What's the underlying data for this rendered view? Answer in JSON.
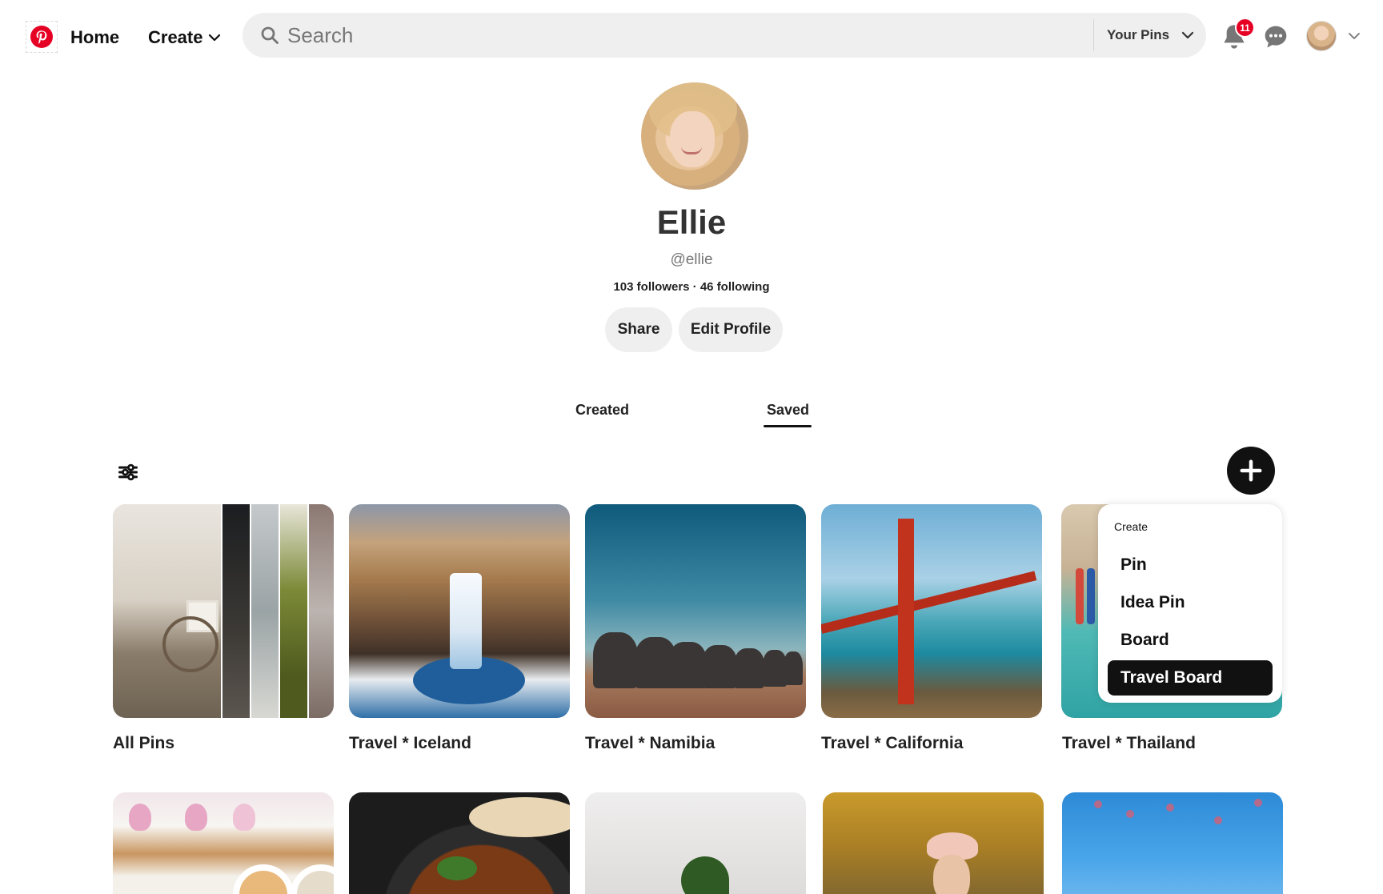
{
  "header": {
    "nav": {
      "home_label": "Home",
      "create_label": "Create"
    },
    "search": {
      "placeholder": "Search",
      "scope_label": "Your Pins"
    },
    "notifications": {
      "count": "11"
    },
    "colors": {
      "brand": "#e60023",
      "search_bg": "#efefef"
    }
  },
  "profile": {
    "name": "Ellie",
    "handle": "@ellie",
    "stats": "103 followers · 46 following",
    "share_label": "Share",
    "edit_label": "Edit Profile"
  },
  "tabs": [
    {
      "label": "Created",
      "active": false
    },
    {
      "label": "Saved",
      "active": true
    }
  ],
  "boards": [
    {
      "title": "All Pins"
    },
    {
      "title": "Travel * Iceland"
    },
    {
      "title": "Travel * Namibia"
    },
    {
      "title": "Travel * California"
    },
    {
      "title": "Travel * Thailand"
    }
  ],
  "create_menu": {
    "header": "Create",
    "items": [
      {
        "label": "Pin",
        "highlighted": false
      },
      {
        "label": "Idea Pin",
        "highlighted": false
      },
      {
        "label": "Board",
        "highlighted": false
      },
      {
        "label": "Travel Board",
        "highlighted": true
      }
    ]
  },
  "icons": {
    "logo": "pinterest-logo-icon",
    "search": "search-icon",
    "notifications": "bell-icon",
    "messages": "chat-bubble-icon",
    "filter": "sliders-icon",
    "create": "plus-icon"
  }
}
